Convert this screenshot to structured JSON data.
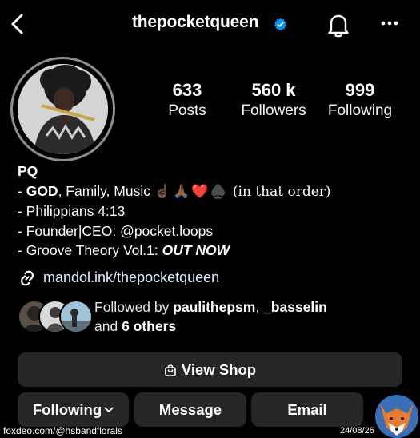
{
  "header": {
    "username": "thepocketqueen",
    "verified": true
  },
  "stats": {
    "posts_count": "633",
    "posts_label": "Posts",
    "followers_count": "560 k",
    "followers_label": "Followers",
    "following_count": "999",
    "following_label": "Following"
  },
  "bio": {
    "name": "PQ",
    "line1_prefix": "- ",
    "line1_bold": "GOD",
    "line1_rest": ", Family, Music ",
    "line1_emojis": "☝🏿🙏🏾❤️♠️",
    "line1_suffix": " (in that order)",
    "line2": "- Philippians 4:13",
    "line3": "- Founder|CEO: @pocket.loops",
    "line4_prefix": "- Groove Theory Vol.1: ",
    "line4_bold": "OUT NOW"
  },
  "link": {
    "text": "mandol.ink/thepocketqueen"
  },
  "followed_by": {
    "prefix": "Followed by ",
    "user1": "paulithepsm",
    "separator": ", ",
    "user2": "_basselin",
    "line2_prefix": "and ",
    "others": "6 others"
  },
  "buttons": {
    "view_shop": "View Shop",
    "following": "Following",
    "message": "Message",
    "email": "Email"
  },
  "footer": {
    "source": "foxdeo.com/@hsbandflorals",
    "date": "24/08/26"
  },
  "colors": {
    "background": "#000000",
    "button_bg": "#262626",
    "verified_blue": "#0095f6"
  }
}
